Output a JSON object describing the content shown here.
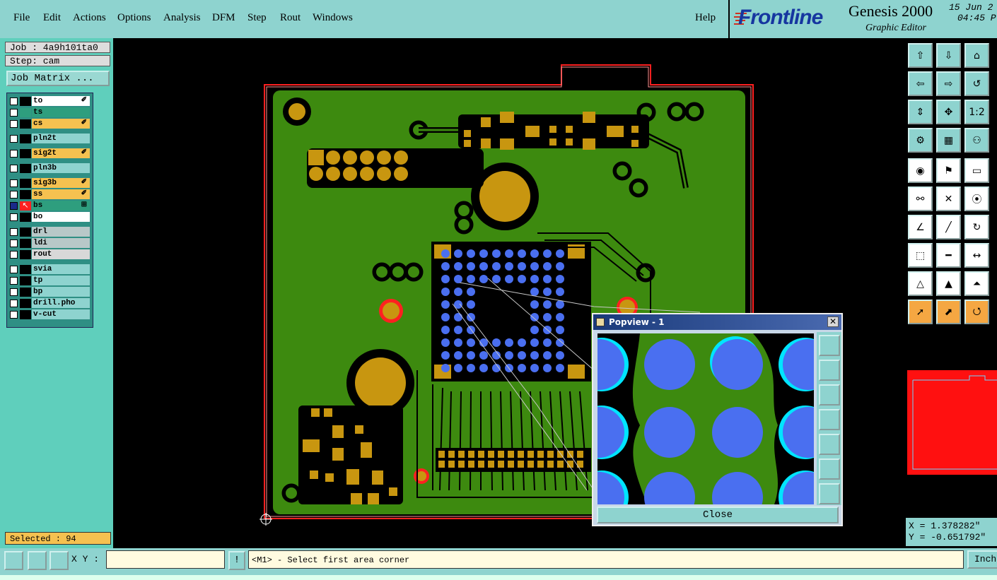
{
  "menubar": {
    "items": [
      "File",
      "Edit",
      "Actions",
      "Options",
      "Analysis",
      "DFM",
      "Step",
      "Rout",
      "Windows"
    ],
    "help": "Help"
  },
  "brand": {
    "logo": "Frontline",
    "product": "Genesis 2000",
    "subtitle": "Graphic Editor",
    "date": "15 Jun 2",
    "time": "04:45 P"
  },
  "left": {
    "job": "Job : 4a9h101ta0",
    "step": "Step: cam",
    "matrix_button": "Job Matrix ...",
    "layers": [
      {
        "name": "to",
        "color": "#ffffff",
        "tag": "✐"
      },
      {
        "name": "ts",
        "color": "#2e9e7e",
        "tag": ""
      },
      {
        "name": "cs",
        "color": "#f5c150",
        "tag": "✐"
      },
      {
        "name": "pln2t",
        "color": "#8ed3cf",
        "tag": ""
      },
      {
        "name": "sig2t",
        "color": "#f5c150",
        "tag": "✐"
      },
      {
        "name": "pln3b",
        "color": "#8ed3cf",
        "tag": ""
      },
      {
        "name": "sig3b",
        "color": "#f5c150",
        "tag": "✐"
      },
      {
        "name": "ss",
        "color": "#f5c150",
        "tag": "✐"
      },
      {
        "name": "bs",
        "color": "#2e9e7e",
        "tag": "⊞"
      },
      {
        "name": "bo",
        "color": "#ffffff",
        "tag": ""
      },
      {
        "name": "drl",
        "color": "#b8c8c8",
        "tag": ""
      },
      {
        "name": "ldi",
        "color": "#b8c8c8",
        "tag": ""
      },
      {
        "name": "rout",
        "color": "#d8d8d8",
        "tag": ""
      },
      {
        "name": "svia",
        "color": "#8ed3cf",
        "tag": ""
      },
      {
        "name": "tp",
        "color": "#8ed3cf",
        "tag": ""
      },
      {
        "name": "bp",
        "color": "#8ed3cf",
        "tag": ""
      },
      {
        "name": "drill.pho",
        "color": "#8ed3cf",
        "tag": ""
      },
      {
        "name": "v-cut",
        "color": "#8ed3cf",
        "tag": ""
      }
    ],
    "selected": "Selected : 94"
  },
  "coords": {
    "x": "X = 1.378282\"",
    "y": "Y = -0.651792\""
  },
  "bottom": {
    "xy_label": "X Y :",
    "xy_value": "",
    "status": "<M1> - Select first area corner",
    "unit": "Inch",
    "exclaim": "!"
  },
  "popview": {
    "title": "Popview - 1",
    "close": "Close"
  },
  "colors": {
    "board": "#3d8a0f",
    "copper": "#c89610",
    "outline": "#ff2020",
    "pad": "#4a6ff0",
    "highlight": "#00e5ff"
  },
  "toolbar_icons": [
    "up-arrow-page",
    "down-arrow-page",
    "home",
    "left-page",
    "right-page",
    "undo-page",
    "fit-vertical",
    "fit-center",
    "scale-1-2",
    "settings-wrench",
    "grid",
    "layers-net",
    "measure-circle",
    "measure-flag",
    "ruler",
    "connect-nodes",
    "cross-x",
    "point-link",
    "angle-tool",
    "line-tool",
    "rotate-arc",
    "node-edit",
    "line-mid",
    "range-tool",
    "triangle-a",
    "triangle-b",
    "triangle-c",
    "pointer",
    "pointer-box",
    "pointer-circle"
  ]
}
